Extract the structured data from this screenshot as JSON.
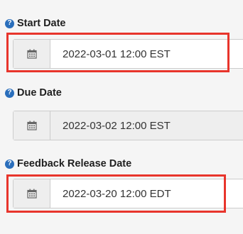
{
  "fields": [
    {
      "label": "Start Date",
      "value": "2022-03-01 12:00 EST",
      "help_icon": "question-circle-icon",
      "calendar_icon": "calendar-icon",
      "disabled": false,
      "highlighted": true
    },
    {
      "label": "Due Date",
      "value": "2022-03-02 12:00 EST",
      "help_icon": "question-circle-icon",
      "calendar_icon": "calendar-icon",
      "disabled": true,
      "highlighted": false
    },
    {
      "label": "Feedback Release Date",
      "value": "2022-03-20 12:00 EDT",
      "help_icon": "question-circle-icon",
      "calendar_icon": "calendar-icon",
      "disabled": false,
      "highlighted": true
    }
  ],
  "colors": {
    "highlight": "#e8352c",
    "help_icon": "#2a6ebb",
    "input_border": "#cccccc",
    "addon_background": "#eeeeee"
  }
}
